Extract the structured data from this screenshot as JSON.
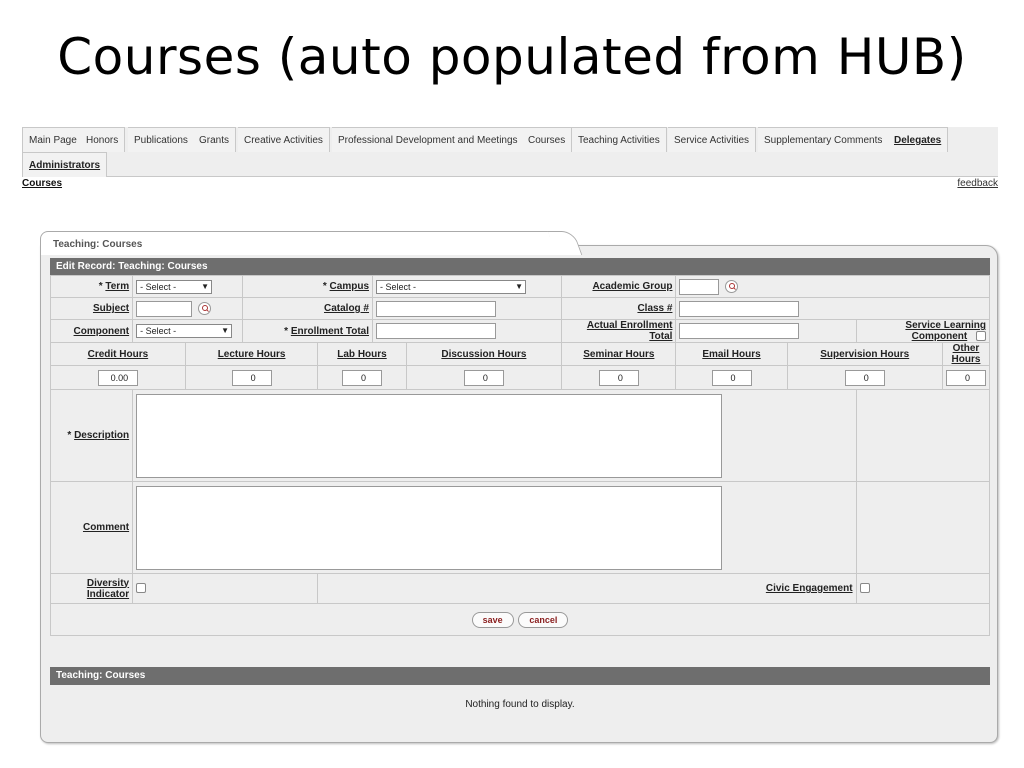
{
  "slide": {
    "title": "Courses (auto populated from HUB)"
  },
  "tabs": {
    "row1": [
      "Main Page",
      "Honors",
      "Publications",
      "Grants",
      "Creative Activities",
      "Professional Development and Meetings",
      "Courses",
      "Teaching Activities",
      "Service Activities",
      "Supplementary Comments",
      "Delegates"
    ],
    "row2": [
      "Administrators"
    ]
  },
  "breadcrumb": "Courses",
  "feedback": "feedback",
  "panel": {
    "tab_label": "Teaching: Courses",
    "edit_header": "Edit Record: Teaching: Courses",
    "list_header": "Teaching: Courses",
    "empty_message": "Nothing found to display."
  },
  "form": {
    "term": {
      "label": "Term",
      "value": "- Select -"
    },
    "campus": {
      "label": "Campus",
      "value": "- Select -"
    },
    "academic_group": {
      "label": "Academic Group",
      "value": ""
    },
    "subject": {
      "label": "Subject",
      "value": ""
    },
    "catalog": {
      "label": "Catalog #",
      "value": ""
    },
    "class": {
      "label": "Class #",
      "value": ""
    },
    "component": {
      "label": "Component",
      "value": "- Select -"
    },
    "enrollment_total": {
      "label": "Enrollment Total",
      "value": ""
    },
    "actual_enrollment_total": {
      "label": "Actual Enrollment Total",
      "value": ""
    },
    "service_learning": {
      "label": "Service Learning Component"
    },
    "hours": {
      "credit": {
        "label": "Credit Hours",
        "value": "0.00"
      },
      "lecture": {
        "label": "Lecture Hours",
        "value": "0"
      },
      "lab": {
        "label": "Lab Hours",
        "value": "0"
      },
      "discussion": {
        "label": "Discussion Hours",
        "value": "0"
      },
      "seminar": {
        "label": "Seminar Hours",
        "value": "0"
      },
      "email": {
        "label": "Email Hours",
        "value": "0"
      },
      "supervision": {
        "label": "Supervision Hours",
        "value": "0"
      },
      "other": {
        "label": "Other Hours",
        "value": "0"
      }
    },
    "description": {
      "label": "Description"
    },
    "comment": {
      "label": "Comment"
    },
    "diversity": {
      "label_line1": "Diversity",
      "label_line2": "Indicator"
    },
    "civic": {
      "label": "Civic Engagement"
    },
    "required_mark": "*"
  },
  "buttons": {
    "save": "save",
    "cancel": "cancel"
  }
}
